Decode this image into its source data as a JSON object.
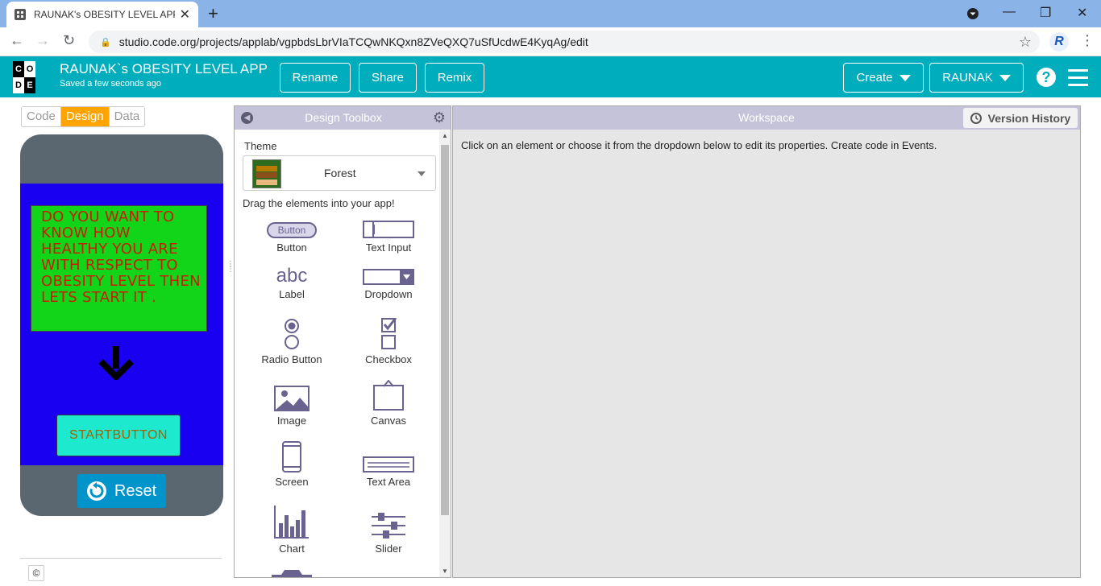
{
  "browser": {
    "tab_title": "RAUNAK's OBESITY LEVEL APP -",
    "url": "studio.code.org/projects/applab/vgpbdsLbrVIaTCQwNKQxn8ZVeQXQ7uSfUcdwE4KyqAg/edit",
    "profile_initial": "R"
  },
  "header": {
    "logo_letters": [
      "C",
      "O",
      "D",
      "E"
    ],
    "app_name": "RAUNAK`s OBESITY LEVEL APP",
    "saved_status": "Saved a few seconds ago",
    "rename": "Rename",
    "share": "Share",
    "remix": "Remix",
    "create": "Create",
    "user": "RAUNAK",
    "help": "?"
  },
  "mode_tabs": [
    "Code",
    "Design",
    "Data"
  ],
  "phone": {
    "intro_text": "DO YOU WANT TO KNOW HOW HEALTHY YOU ARE WITH RESPECT TO OBESITY LEVEL THEN LETS START IT .",
    "start_button": "STARTBUTTON",
    "reset_button": "Reset",
    "copyright": "©"
  },
  "toolbox": {
    "title": "Design Toolbox",
    "theme_label": "Theme",
    "theme_value": "Forest",
    "drag_hint": "Drag the elements into your app!",
    "items": [
      "Button",
      "Text Input",
      "Label",
      "Dropdown",
      "Radio Button",
      "Checkbox",
      "Image",
      "Canvas",
      "Screen",
      "Text Area",
      "Chart",
      "Slider"
    ],
    "button_icon_text": "Button",
    "label_icon_text": "abc"
  },
  "workspace": {
    "title": "Workspace",
    "version_history": "Version History",
    "message": "Click on an element or choose it from the dropdown below to edit its properties. Create code in Events."
  },
  "colors": {
    "header_bg": "#00adbc",
    "design_tab": "#ffa400",
    "screen_bg": "#1a00f0",
    "intro_bg": "#12d51a",
    "start_bg": "#1de9cf",
    "reset_bg": "#0094ca"
  }
}
